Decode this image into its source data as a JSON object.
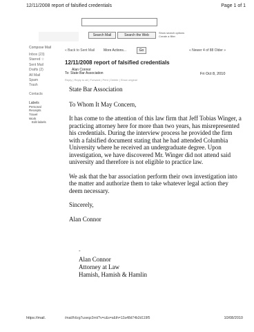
{
  "print_header": {
    "title": "12/11/2008 report of falsified credentials",
    "page": "Page 1 of 1"
  },
  "search": {
    "mail_button": "Search Mail",
    "web_button": "Search the Web",
    "options": [
      "Show search options",
      "Create a filter"
    ]
  },
  "sidebar": {
    "compose": "Compose Mail",
    "items": [
      {
        "label": "Inbox (23)"
      },
      {
        "label": "Starred ☆"
      },
      {
        "label": "Sent Mail"
      },
      {
        "label": "Drafts (2)"
      },
      {
        "label": "All Mail"
      },
      {
        "label": "Spam"
      },
      {
        "label": "Trash"
      }
    ],
    "contacts": "Contacts",
    "labels_heading": "Labels",
    "labels": [
      {
        "label": "Personal"
      },
      {
        "label": "Receipts"
      },
      {
        "label": "Travel"
      },
      {
        "label": "Work"
      }
    ],
    "edit_labels": "Edit labels"
  },
  "toolbar": {
    "back": "« Back to Sent Mail",
    "more_actions": "More Actions...",
    "go": "Go",
    "pager": "« Newer 4 of 88 Older »"
  },
  "message": {
    "subject": "12/11/2008 report of falsified credentials",
    "from": "Alan Connor",
    "to": "To: State Bar Association",
    "date": "Fri Oct 8, 2010",
    "actions": "Reply | Reply to all | Forward | Print | Delete | Show original"
  },
  "letter": {
    "address": "State Bar Association",
    "salutation": "To Whom It May Concern,",
    "paragraphs": [
      "It has come to the attention of this law firm that Jeff Tobias Winger, a practicing attorney here for more than two years, has misrepresented his credentials. During the interview process he provided the firm with a falsified document stating that he had attended Columbia University where he received an undergraduate degree. Upon investigation, we have discovered Mr. Winger did not attend said university and therefore is not eligible to practice law.",
      "We ask that the bar association perform their own investigation into the matter and authorize them to take whatever legal action they deem necessary."
    ],
    "closing": "Sincerely,",
    "signer": "Alan Connor"
  },
  "signature_block": {
    "mark": "-",
    "name": "Alan Connor",
    "title": "Attorney at Law",
    "firm": "Hamish, Hamish & Hamlin"
  },
  "print_footer": {
    "url_start": "https://mail.",
    "url_rest": "/mail/h/izg7useqz2mt/?v=c&s=s&th=12a48d74b2d119f5",
    "date": "10/08/2010"
  }
}
